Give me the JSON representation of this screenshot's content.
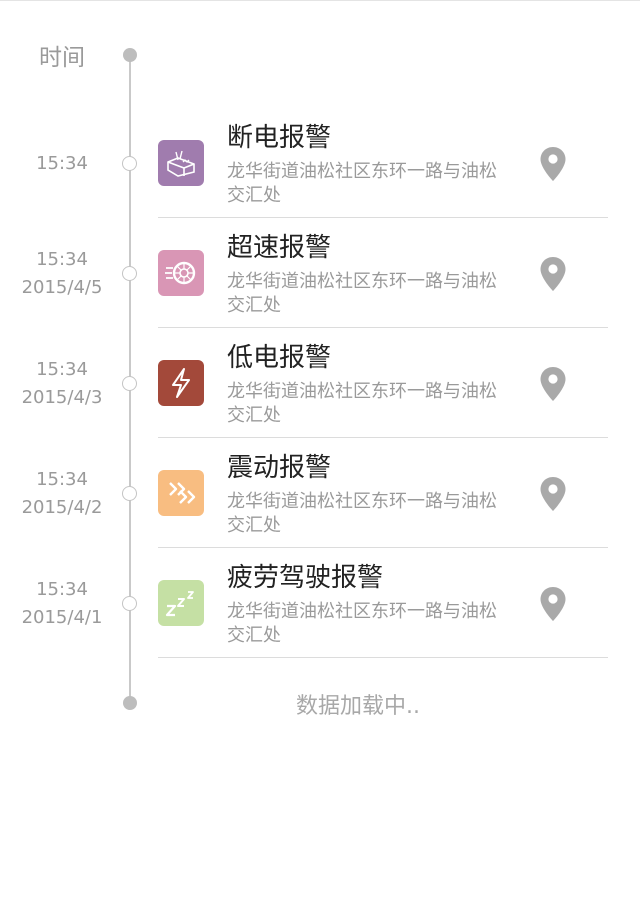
{
  "header": {
    "time_label": "时间"
  },
  "alarms": [
    {
      "time": "15:34",
      "date": "",
      "title": "断电报警",
      "address": "龙华街道油松社区东环一路与油松交汇处",
      "icon": "power-cut-icon",
      "color": "#a07cae"
    },
    {
      "time": "15:34",
      "date": "2015/4/5",
      "title": "超速报警",
      "address": "龙华街道油松社区东环一路与油松交汇处",
      "icon": "speeding-wheel-icon",
      "color": "#d996b5"
    },
    {
      "time": "15:34",
      "date": "2015/4/3",
      "title": "低电报警",
      "address": "龙华街道油松社区东环一路与油松交汇处",
      "icon": "low-power-bolt-icon",
      "color": "#a3493a"
    },
    {
      "time": "15:34",
      "date": "2015/4/2",
      "title": "震动报警",
      "address": "龙华街道油松社区东环一路与油松交汇处",
      "icon": "vibration-icon",
      "color": "#f8bd81"
    },
    {
      "time": "15:34",
      "date": "2015/4/1",
      "title": "疲劳驾驶报警",
      "address": "龙华街道油松社区东环一路与油松交汇处",
      "icon": "fatigue-zzz-icon",
      "color": "#c5e0a4"
    }
  ],
  "footer": {
    "loading_text": "数据加载中.."
  }
}
